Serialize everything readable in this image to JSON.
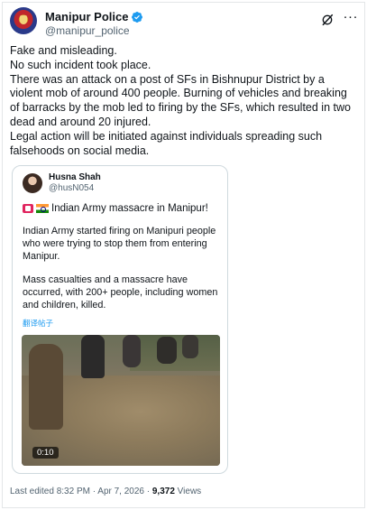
{
  "post": {
    "author": {
      "display_name": "Manipur Police",
      "handle": "@manipur_police",
      "verified": true
    },
    "text_lines": [
      "Fake and misleading.",
      "No such incident took place.",
      "There was an attack on a post of SFs in Bishnupur District by a violent mob of around 400 people. Burning of vehicles and breaking of barracks by the mob led to firing by the SFs, which resulted in two dead and around 20 injured.",
      "Legal action will be initiated against individuals spreading such falsehoods on social media."
    ],
    "meta": {
      "edited_label": "Last edited 8:32 PM · Apr 7, 2026 · ",
      "views_count": "9,372",
      "views_label": " Views"
    },
    "icons": {
      "verified": "verified-badge-icon",
      "grok": "grok-icon",
      "more": "more-options-icon"
    },
    "accent_color": "#1d9bf0"
  },
  "quoted_post": {
    "author": {
      "display_name": "Husna Shah",
      "handle": "@husN054"
    },
    "title": "Indian Army massacre in Manipur!",
    "paragraphs": [
      "Indian Army started firing on Manipuri people who were trying to stop them from entering Manipur.",
      "Mass casualties and a massacre have occurred, with 200+ people, including women and children, killed."
    ],
    "translate_label": "翻译帖子",
    "video": {
      "duration": "0:10"
    }
  }
}
